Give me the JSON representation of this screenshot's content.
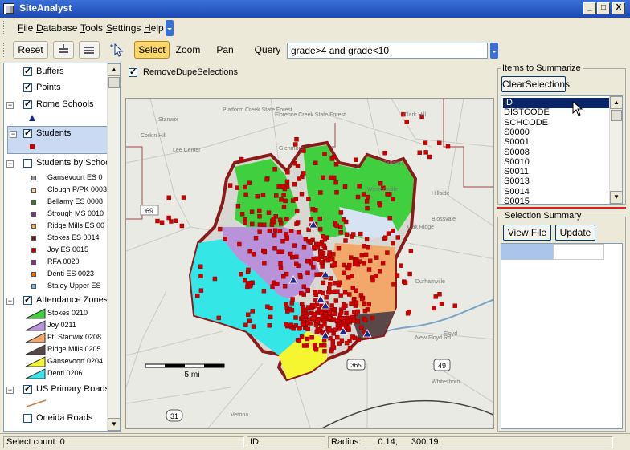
{
  "window": {
    "title": "SiteAnalyst",
    "min_glyph": "_",
    "max_glyph": "□",
    "close_glyph": "X"
  },
  "menu": [
    "File",
    "Database",
    "Tools",
    "Settings",
    "Help"
  ],
  "toolbar": {
    "reset": "Reset",
    "select": "Select",
    "zoom": "Zoom",
    "pan": "Pan",
    "query_label": "Query",
    "query_value": "grade>4 and grade<10"
  },
  "legend": {
    "layers": [
      {
        "label": "Buffers",
        "checked": true
      },
      {
        "label": "Points",
        "checked": true
      },
      {
        "label": "Rome Schools",
        "checked": true
      },
      {
        "label": "Students",
        "checked": true
      },
      {
        "label": "Students by School",
        "checked": false
      },
      {
        "label": "Attendance Zones",
        "checked": true
      },
      {
        "label": "US Primary Roads",
        "checked": true
      },
      {
        "label": "Oneida Roads",
        "checked": false
      }
    ],
    "schools": [
      {
        "label": "Gansevoort ES 0",
        "color": "#9a9a9a"
      },
      {
        "label": "Clough P/PK 0003",
        "color": "#f5d3a0"
      },
      {
        "label": "Bellamy ES 0008",
        "color": "#3a7a2a"
      },
      {
        "label": "Strough MS 0010",
        "color": "#7a3090"
      },
      {
        "label": "Ridge Mills ES 00",
        "color": "#f5b060"
      },
      {
        "label": "Stokes ES 0014",
        "color": "#6a1a1a"
      },
      {
        "label": "Joy ES 0015",
        "color": "#c00000"
      },
      {
        "label": "RFA 0020",
        "color": "#8a2a8a"
      },
      {
        "label": "Denti ES 0023",
        "color": "#e07000"
      },
      {
        "label": "Staley Upper ES",
        "color": "#7abaea"
      }
    ],
    "zones": [
      {
        "label": "Stokes 0210",
        "color": "#3fcf3f"
      },
      {
        "label": "Joy 0211",
        "color": "#b993d9"
      },
      {
        "label": "Ft. Stanwix 0208",
        "color": "#f2a86a"
      },
      {
        "label": "Ridge Mills 0205",
        "color": "#5a4848"
      },
      {
        "label": "Gansevoort 0204",
        "color": "#f5f530"
      },
      {
        "label": "Denti 0206",
        "color": "#35e6e6"
      }
    ]
  },
  "map": {
    "remove_dupes_label": "RemoveDupeSelections",
    "scale_label": "5 mi",
    "place_labels": [
      "Platform Creek State Forest",
      "Florence Creek State Forest",
      "Clark Hill",
      "Corkin Hill",
      "Glenmore",
      "Taberg",
      "Hillside",
      "Blossvale",
      "Oak Ridge",
      "Lee Center",
      "Westernville",
      "Stanwix",
      "Verona",
      "Durhamville",
      "Floyd",
      "New Floyd Rd",
      "Whitesboro"
    ],
    "road_shields": [
      "69",
      "49",
      "31",
      "365"
    ]
  },
  "summary": {
    "items_title": "Items to Summarize",
    "clear_btn": "ClearSelections",
    "fields": [
      "ID",
      "DISTCODE",
      "SCHCODE",
      "S0000",
      "S0001",
      "S0008",
      "S0010",
      "S0011",
      "S0013",
      "S0014",
      "S0015"
    ],
    "selection_title": "Selection Summary",
    "view_btn": "View File",
    "update_btn": "Update"
  },
  "status": {
    "count": "Select count: 0",
    "field": "ID",
    "radius_label": "Radius:",
    "radius_value": "0.14;",
    "radius_value2": "300.19"
  }
}
